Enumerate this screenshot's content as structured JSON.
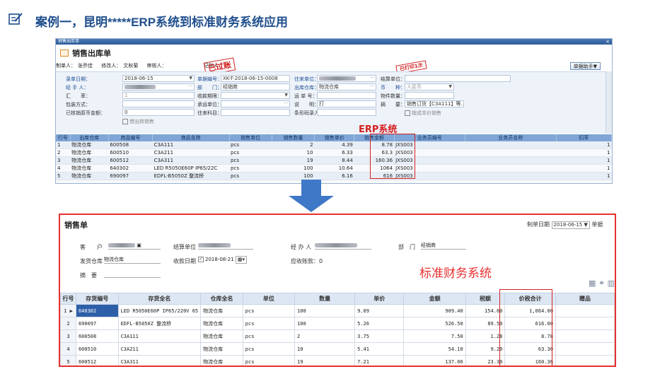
{
  "header": {
    "title": "案例一，昆明*****ERP系统到标准财务系统应用",
    "icon": "edit-document-icon"
  },
  "erp": {
    "window_title": "销售出库单",
    "close_glyph": "×",
    "doc_title": "销售出库单",
    "head_line": {
      "maker_label": "制单人：",
      "maker": "张乔佳",
      "editor_label": "修改人：",
      "editor": "文秋菊",
      "auditor_label": "审核人：",
      "bookkeeper_label": "记账人："
    },
    "stamp_passed": "已过账",
    "stamp_printed": "已打印1次",
    "help_button": "单据助手▼",
    "form": {
      "date_label": "录单日期：",
      "date_value": "2018-06-15",
      "docno_label": "单据编号：",
      "docno_value": "XK-T-2018-06-15-0008",
      "partner_label": "往来单位：",
      "settle_label": "结算单位：",
      "handler_label": "经 手 人：",
      "dept_label": "部　　门：",
      "dept_value": "经销商",
      "warehouse_label": "出库仓库：",
      "warehouse_value": "物流仓库",
      "currency_label": "币　　种：",
      "currency_value": "人民币",
      "rate_label": "汇　　率：",
      "rate_value": "1",
      "terms_label": "收款期限：",
      "shipno_label": "运 单 号：",
      "qty_label": "物件数量：",
      "pack_label": "包装方式：",
      "consignee_label": "承运单位：",
      "note_label": "说　　明：",
      "note_value": "打",
      "summary_label": "摘　　要：",
      "summary_value": "销售订货【C3A111】等…",
      "paid_label": "已核销原币金额：",
      "paid_value": "0",
      "account_label": "往来科目：",
      "barcode_label": "条形码录入",
      "cost_label": "按成本价销售",
      "writeoff_label": "借出转销售",
      "system_label": "ERP系统"
    },
    "columns": [
      "行号",
      "出库仓库",
      "商品编号",
      "商品名称",
      "销售单位",
      "销售数量",
      "销售单价",
      "销售金额",
      "业务员编号",
      "业务员名称",
      "扣率"
    ],
    "rows": [
      [
        "1",
        "物流仓库",
        "600508",
        "C3A111",
        "pcs",
        "2",
        "4.39",
        "8.78",
        "JXS003",
        "",
        "1"
      ],
      [
        "2",
        "物流仓库",
        "600510",
        "C3A211",
        "pcs",
        "10",
        "6.33",
        "63.3",
        "JXS003",
        "",
        "1"
      ],
      [
        "3",
        "物流仓库",
        "600512",
        "C3A311",
        "pcs",
        "19",
        "8.44",
        "160.36",
        "JXS003",
        "",
        "1"
      ],
      [
        "4",
        "物流仓库",
        "640302",
        "LED R5050E60P IP65/22C",
        "pcs",
        "100",
        "10.64",
        "1064",
        "JXS003",
        "",
        "1"
      ],
      [
        "5",
        "物流仓库",
        "690097",
        "EDFL-B5050Z 整流桥",
        "pcs",
        "100",
        "6.16",
        "616",
        "JXS003",
        "",
        "1"
      ]
    ]
  },
  "std": {
    "title": "销售单",
    "date_label": "制单日期",
    "date_value": "2018-06-15",
    "extra_label": "单据",
    "customer_label": "客　　户",
    "settle_label": "结算单位",
    "handler_label": "经 办 人",
    "dept_label": "部　门",
    "dept_value": "经销商",
    "warehouse_label": "发货仓库",
    "warehouse_value": "物流仓库",
    "recv_date_label": "收款日期",
    "recv_date_value": "2018-08-21",
    "receivable_label": "应收账款：",
    "receivable_value": "0",
    "summary_label": "摘　要",
    "system_label": "标准财务系统",
    "columns": [
      "行号",
      "存货编号",
      "存货全名",
      "仓库全名",
      "单位",
      "数量",
      "单价",
      "金额",
      "税额",
      "价税合计",
      "赠品"
    ],
    "rows": [
      [
        "1",
        "640302",
        "LED R5050E60P IP65/220V 65",
        "物流仓库",
        "pcs",
        "100",
        "9.09",
        "909.40",
        "154.60",
        "1,064.00",
        ""
      ],
      [
        "2",
        "690097",
        "EDFL-B5050Z 整流桥",
        "物流仓库",
        "pcs",
        "100",
        "5.26",
        "526.50",
        "89.50",
        "616.00",
        ""
      ],
      [
        "3",
        "600508",
        "C3A111",
        "物流仓库",
        "pcs",
        "2",
        "3.75",
        "7.50",
        "1.28",
        "8.78",
        ""
      ],
      [
        "4",
        "600510",
        "C3A211",
        "物流仓库",
        "pcs",
        "10",
        "5.41",
        "54.10",
        "9.20",
        "63.30",
        ""
      ],
      [
        "5",
        "600512",
        "C3A311",
        "物流仓库",
        "pcs",
        "19",
        "7.21",
        "137.06",
        "23.30",
        "160.36",
        ""
      ]
    ]
  },
  "colors": {
    "brand_blue": "#1f4e8c",
    "highlight_red": "#d42020",
    "arrow_blue": "#3f78c7"
  }
}
